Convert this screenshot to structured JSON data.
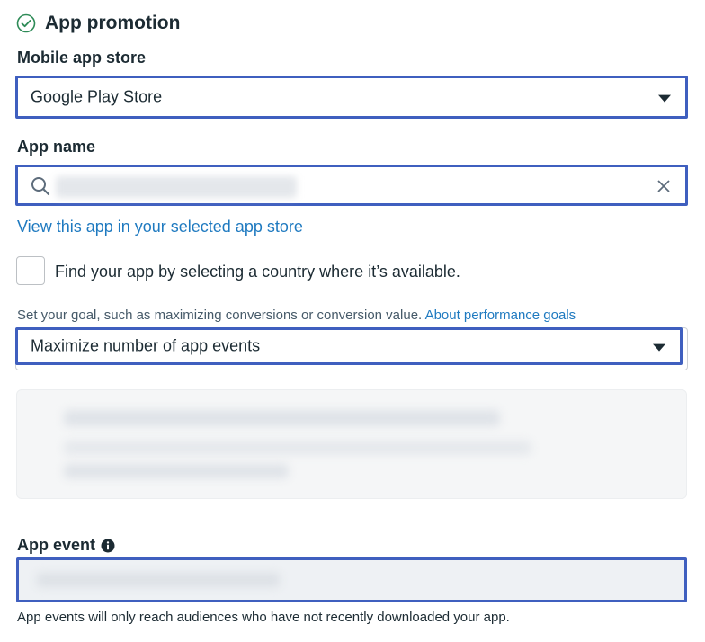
{
  "section": {
    "title": "App promotion",
    "icon": "check-circle-icon"
  },
  "store": {
    "label": "Mobile app store",
    "value": "Google Play Store"
  },
  "app_name": {
    "label": "App name",
    "value": ""
  },
  "links": {
    "view_app": "View this app in your selected app store"
  },
  "country_option": {
    "label": "Find your app by selecting a country where it’s available.",
    "checked": false
  },
  "goal": {
    "helper": "Set your goal, such as maximizing conversions or conversion value.",
    "helper_link": "About performance goals",
    "value": "Maximize number of app events"
  },
  "app_event": {
    "label": "App event",
    "info_icon": "info-icon",
    "helper": "App events will only reach audiences who have not recently downloaded your app."
  },
  "colors": {
    "accent_border": "#3f5fbf",
    "link": "#1f7ac0",
    "check": "#2e8b57"
  }
}
